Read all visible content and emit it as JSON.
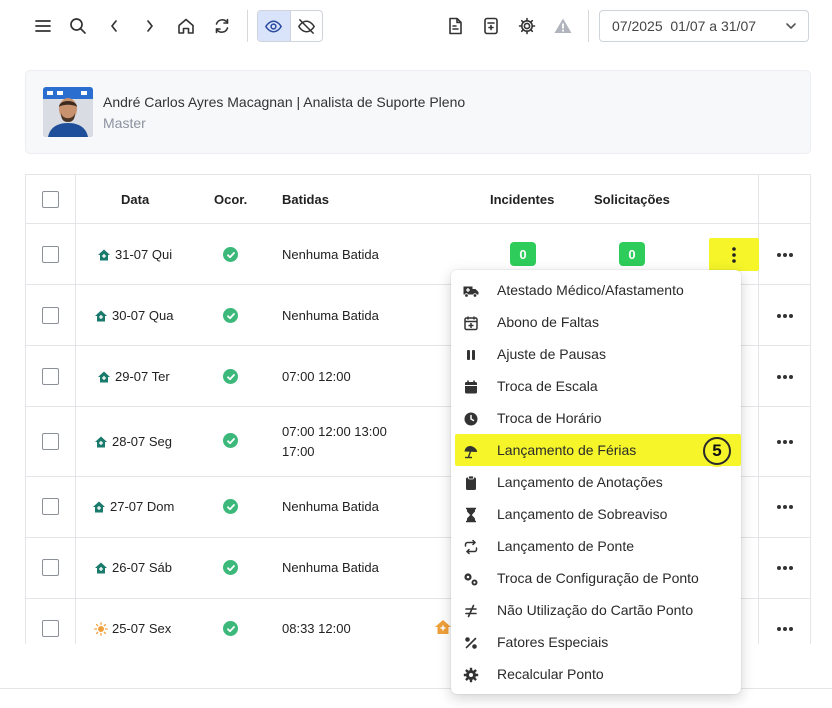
{
  "period": {
    "label": "07/2025  01/07 a 31/07"
  },
  "user": {
    "name": "André Carlos Ayres Macagnan | Analista de Suporte Pleno",
    "role": "Master"
  },
  "table": {
    "headers": {
      "data": "Data",
      "ocor": "Ocor.",
      "batidas": "Batidas",
      "incidentes": "Incidentes",
      "solicitacoes": "Solicitações"
    },
    "rows": [
      {
        "date": "31-07 Qui",
        "batidas": "Nenhuma Batida",
        "incidentes": "0",
        "solicitacoes": "0"
      },
      {
        "date": "30-07 Qua",
        "batidas": "Nenhuma Batida"
      },
      {
        "date": "29-07 Ter",
        "batidas": "07:00 12:00"
      },
      {
        "date": "28-07 Seg",
        "batidas": "07:00 12:00 13:00",
        "batidas2": "17:00"
      },
      {
        "date": "27-07 Dom",
        "batidas": "Nenhuma Batida"
      },
      {
        "date": "26-07 Sáb",
        "batidas": "Nenhuma Batida"
      },
      {
        "date": "25-07 Sex",
        "batidas": "08:33 12:00"
      }
    ]
  },
  "menu": {
    "items": [
      {
        "label": "Atestado Médico/Afastamento",
        "icon": "ambulance-icon"
      },
      {
        "label": "Abono de Faltas",
        "icon": "calendar-plus-icon"
      },
      {
        "label": "Ajuste de Pausas",
        "icon": "pause-icon"
      },
      {
        "label": "Troca de Escala",
        "icon": "calendar-icon"
      },
      {
        "label": "Troca de Horário",
        "icon": "clock-icon"
      },
      {
        "label": "Lançamento de Férias",
        "icon": "umbrella-beach-icon"
      },
      {
        "label": "Lançamento de Anotações",
        "icon": "clipboard-icon"
      },
      {
        "label": "Lançamento de Sobreaviso",
        "icon": "hourglass-icon"
      },
      {
        "label": "Lançamento de Ponte",
        "icon": "repeat-icon"
      },
      {
        "label": "Troca de Configuração de Ponto",
        "icon": "gears-icon"
      },
      {
        "label": "Não Utilização do Cartão Ponto",
        "icon": "not-equal-icon"
      },
      {
        "label": "Fatores Especiais",
        "icon": "percent-icon"
      },
      {
        "label": "Recalcular Ponto",
        "icon": "gear-icon"
      }
    ],
    "step_badge": "5"
  },
  "colors": {
    "highlight": "#f5f52a",
    "badge_green": "#2ecc5a",
    "status_green": "#3cb97a",
    "home_teal": "#1a7a6c",
    "sun_orange": "#f0a03a"
  }
}
